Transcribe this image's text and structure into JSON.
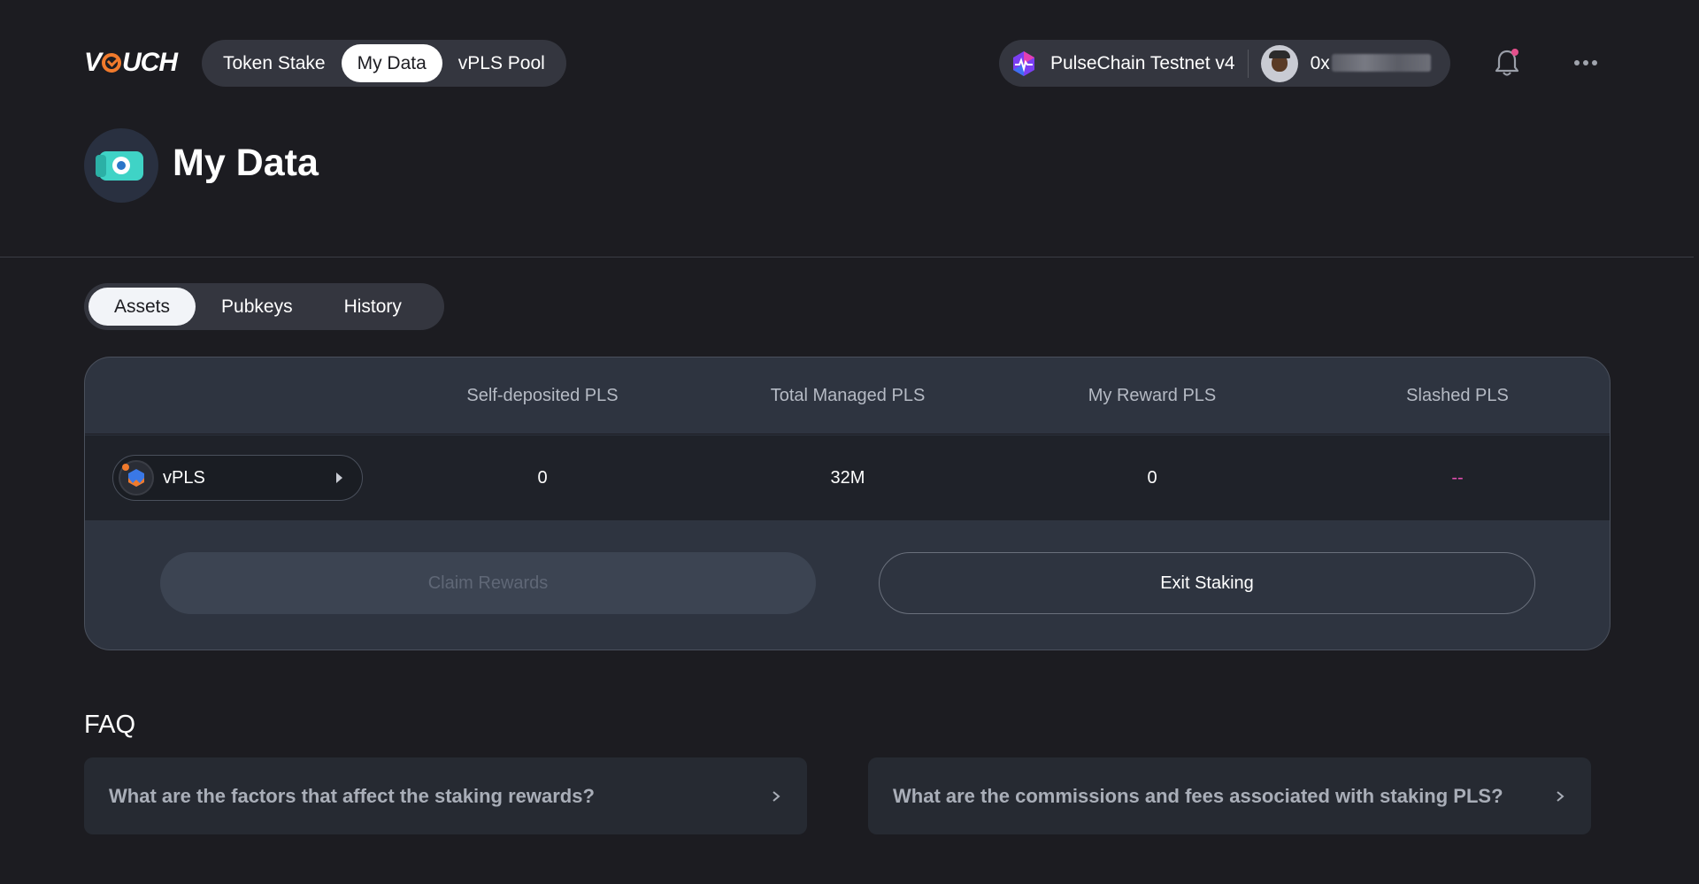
{
  "header": {
    "logo_text": "VOUCH",
    "nav": [
      {
        "label": "Token Stake"
      },
      {
        "label": "My Data"
      },
      {
        "label": "vPLS Pool"
      }
    ],
    "network_label": "PulseChain Testnet v4",
    "address_prefix": "0x",
    "icons": [
      "pulsechain-icon",
      "avatar",
      "bell-icon",
      "more-icon"
    ],
    "colors": {
      "notification_dot": "#e4508c",
      "accent": "#f07a2c"
    }
  },
  "page": {
    "title": "My Data"
  },
  "tabs": [
    {
      "label": "Assets"
    },
    {
      "label": "Pubkeys"
    },
    {
      "label": "History"
    }
  ],
  "assets_table": {
    "headers": [
      "Self-deposited PLS",
      "Total Managed PLS",
      "My Reward PLS",
      "Slashed PLS"
    ],
    "row": {
      "token": "vPLS",
      "self_deposited": "0",
      "total_managed": "32M",
      "my_reward": "0",
      "slashed": "--"
    },
    "claim_label": "Claim Rewards",
    "exit_label": "Exit Staking"
  },
  "faq": {
    "title": "FAQ",
    "items": [
      {
        "question": "What are the factors that affect the staking rewards?"
      },
      {
        "question": "What are the commissions and fees associated with staking PLS?"
      }
    ]
  }
}
